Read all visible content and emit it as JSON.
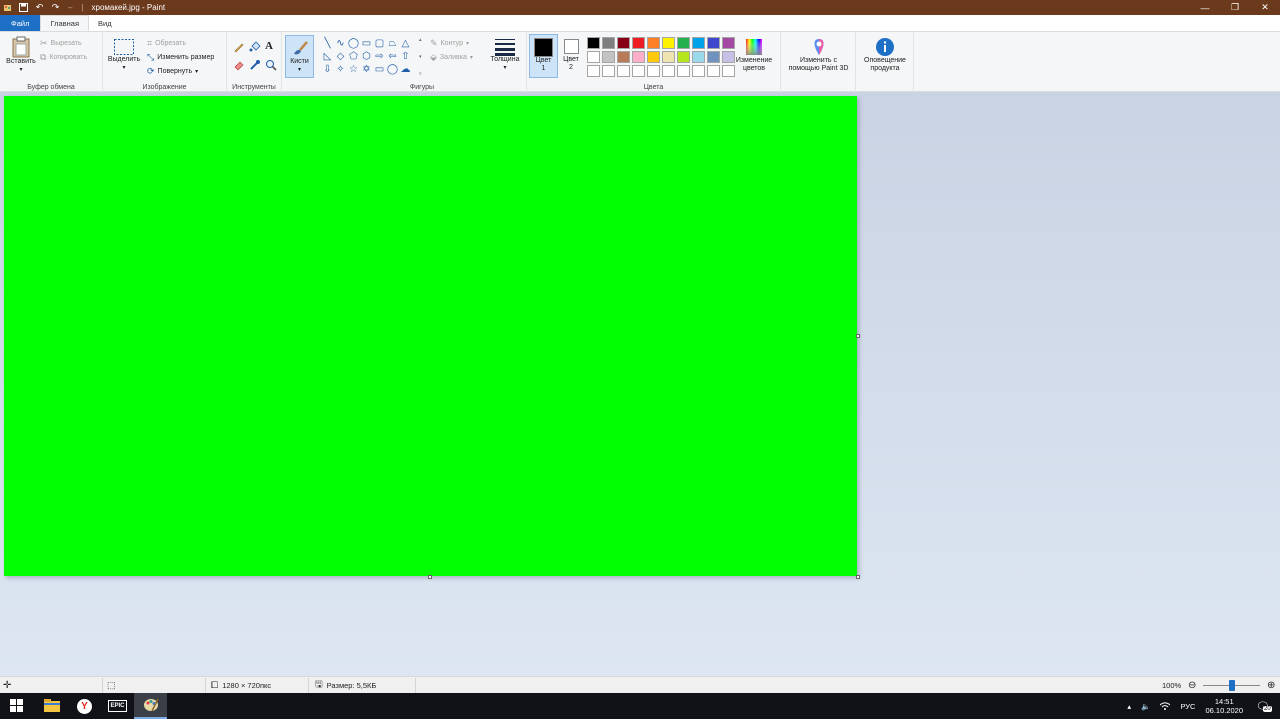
{
  "window": {
    "title": "хромакей.jpg - Paint",
    "quick_access_separator": "–"
  },
  "tabs": [
    {
      "label": "Файл"
    },
    {
      "label": "Главная"
    },
    {
      "label": "Вид"
    }
  ],
  "ribbon": {
    "clipboard": {
      "label": "Буфер обмена",
      "paste": "Вставить",
      "cut": "Вырезать",
      "copy": "Копировать"
    },
    "image": {
      "label": "Изображение",
      "select": "Выделить",
      "crop": "Обрезать",
      "resize": "Изменить размер",
      "rotate": "Повернуть"
    },
    "tools": {
      "label": "Инструменты"
    },
    "brushes": {
      "label": "Кисти"
    },
    "shapes": {
      "label": "Фигуры",
      "outline": "Контур",
      "fill": "Заливка"
    },
    "size": {
      "label": "Толщина"
    },
    "colors": {
      "label": "Цвета",
      "color1_line1": "Цвет",
      "color1_line2": "1",
      "color2_line1": "Цвет",
      "color2_line2": "2",
      "edit_line1": "Изменение",
      "edit_line2": "цветов",
      "palette_row1": [
        "#000000",
        "#7f7f7f",
        "#880015",
        "#ed1c24",
        "#ff7f27",
        "#fff200",
        "#22b14c",
        "#00a2e8",
        "#3f48cc",
        "#a349a4"
      ],
      "palette_row2": [
        "#ffffff",
        "#c3c3c3",
        "#b97a57",
        "#ffaec9",
        "#ffc90e",
        "#efe4b0",
        "#b5e61d",
        "#99d9ea",
        "#7092be",
        "#c8bfe7"
      ],
      "palette_row3": [
        "#ffffff",
        "#ffffff",
        "#ffffff",
        "#ffffff",
        "#ffffff",
        "#ffffff",
        "#ffffff",
        "#ffffff",
        "#ffffff",
        "#ffffff"
      ],
      "color1_value": "#000000",
      "color2_value": "#ffffff"
    },
    "paint3d": {
      "line1": "Изменить с",
      "line2": "помощью Paint 3D"
    },
    "notice": {
      "line1": "Оповещение",
      "line2": "продукта"
    }
  },
  "canvas": {
    "fill_color": "#00ff00"
  },
  "status": {
    "dimensions": "1280 × 720пкс",
    "size": "Размер: 5,5КБ",
    "zoom": "100%",
    "zoom_level": 0.5
  },
  "taskbar": {
    "epic_label": "EPIC",
    "lang": "РУС",
    "time": "14:51",
    "date": "06.10.2020",
    "notifications": "20"
  }
}
